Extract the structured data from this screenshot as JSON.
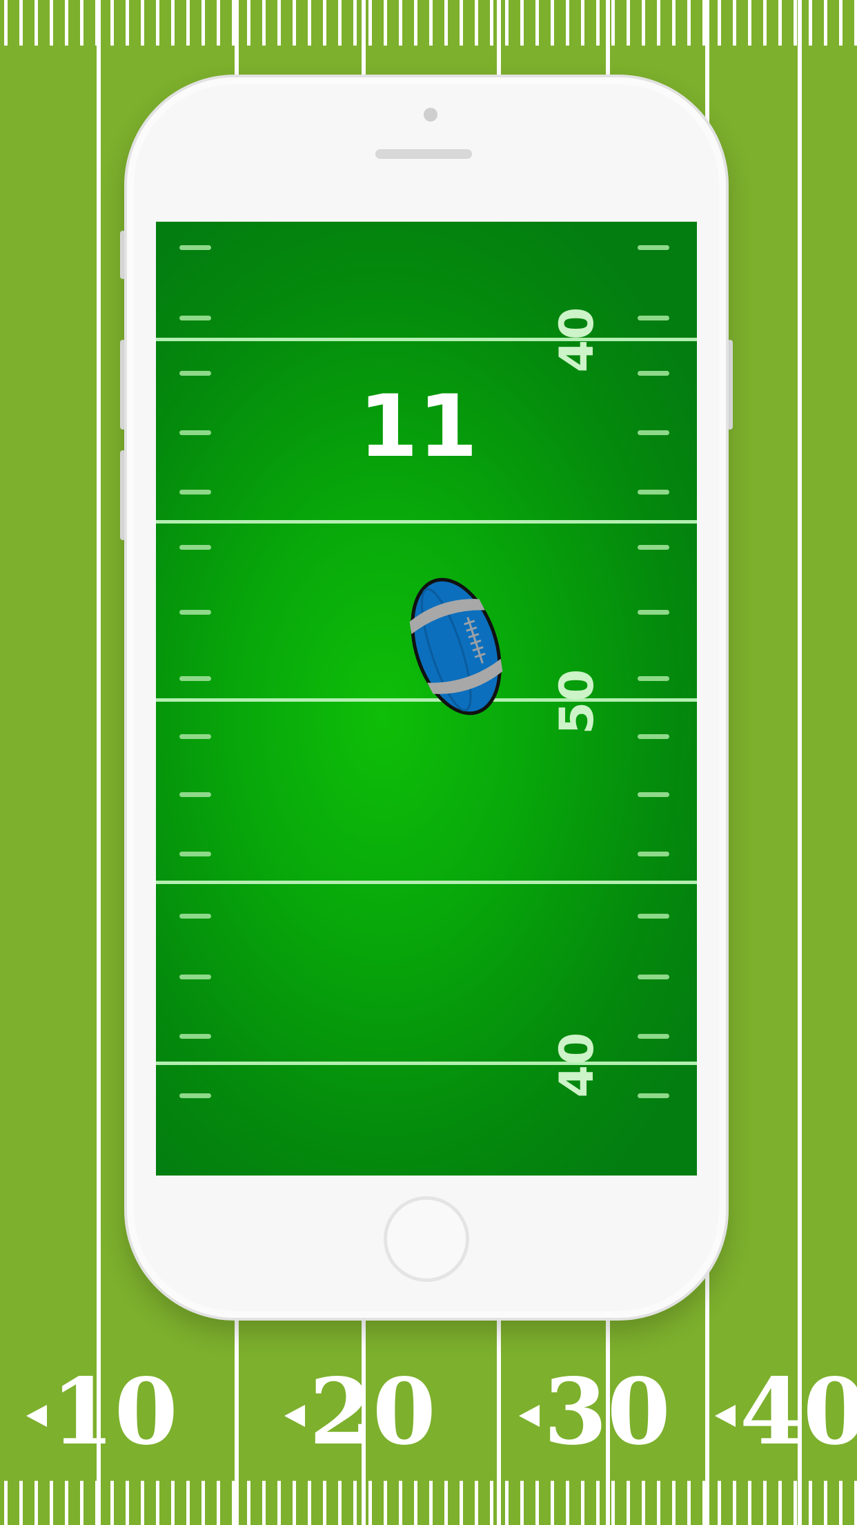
{
  "background": {
    "color": "#7db02d",
    "line_color": "#ffffff",
    "yard_numbers": [
      "10",
      "20",
      "30",
      "40"
    ]
  },
  "screen": {
    "yard_numbers": [
      "40",
      "50",
      "40"
    ],
    "score": "11",
    "ball": {
      "body_color": "#0b6fbd",
      "stripe_color": "#a8a8a8",
      "lace_color": "#9aa0a6"
    },
    "field_center_color": "#0fbe08",
    "field_edge_color": "#037d10"
  }
}
